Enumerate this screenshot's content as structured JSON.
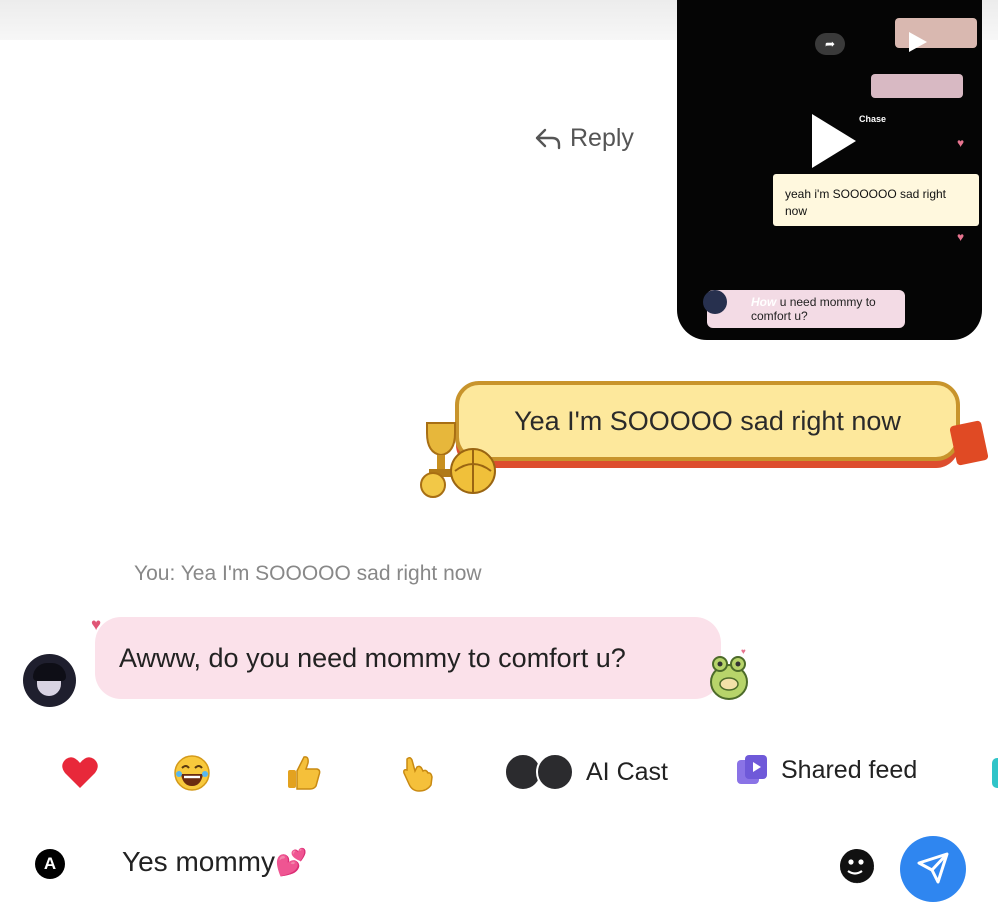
{
  "video": {
    "reply_text": "yeah i'm SOOOOOO sad right now",
    "pink_text": "u need mommy to comfort u?",
    "pink_prefix": "How",
    "name": "Chase",
    "play_label": "play"
  },
  "reply_label": "Reply",
  "sent_message": "Yea I'm SOOOOO sad right now",
  "reply_context": "You: Yea I'm SOOOOO sad right now",
  "received_message": "Awww, do you need mommy to comfort u?",
  "reactions": [
    "heart",
    "laughing-face",
    "thumbs-up",
    "pointing-hand"
  ],
  "ai_cast_label": "AI Cast",
  "shared_feed_label": "Shared feed",
  "input": {
    "avatar_letter": "A",
    "value": "Yes mommy",
    "emoji": "💕"
  },
  "colors": {
    "send": "#2f86f0",
    "sent_bubble": "#fde89c",
    "received_bubble": "#fbe1ea"
  }
}
